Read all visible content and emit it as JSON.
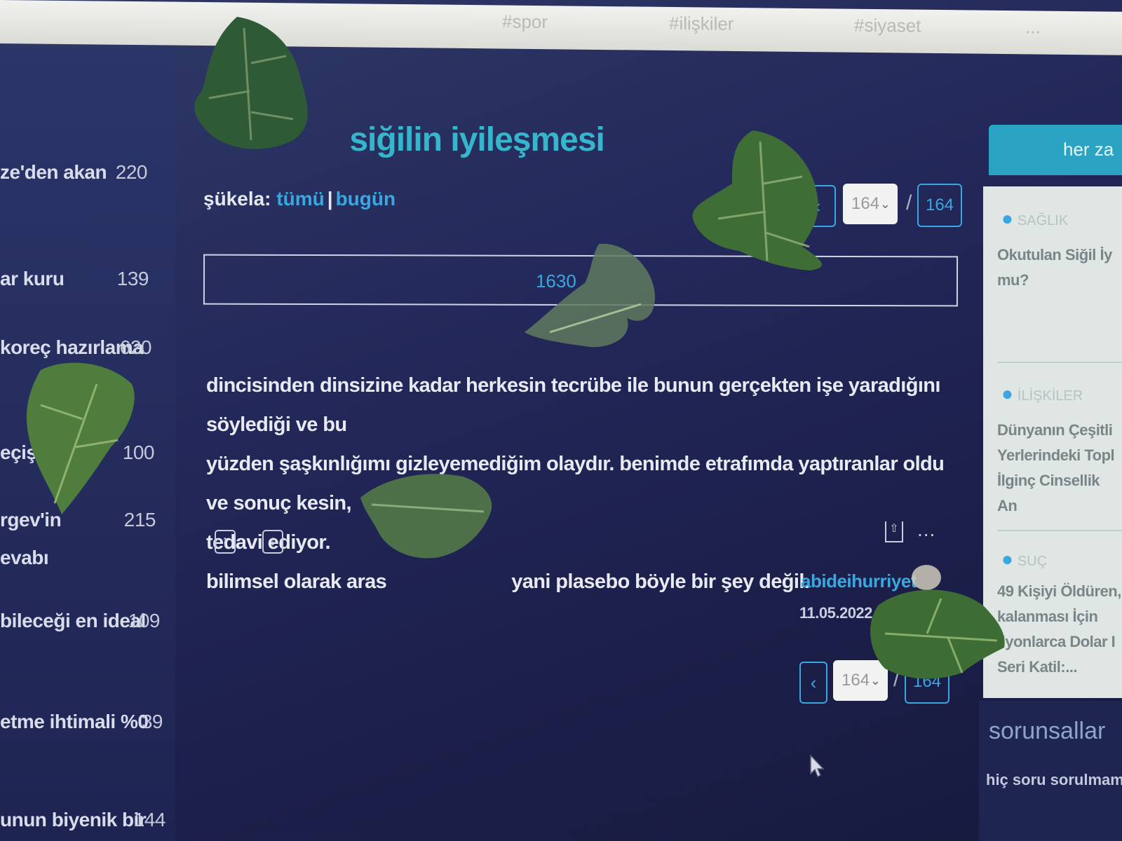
{
  "top_nav": {
    "items": [
      "#spor",
      "#ilişkiler",
      "#siyaset",
      "..."
    ]
  },
  "left_topics": [
    {
      "title": "ze'den akan",
      "count": "220"
    },
    {
      "title": "ar kuru",
      "count": "139"
    },
    {
      "title": "koreç hazırlama",
      "count": "620"
    },
    {
      "title": "eçiş",
      "count": "100"
    },
    {
      "title": "rgev'in",
      "count": "215"
    },
    {
      "title": "evabı",
      "count": ""
    },
    {
      "title": "bileceği en ideal",
      "count": "109"
    },
    {
      "title": "etme ihtimali %0",
      "count": "39"
    },
    {
      "title": "unun biyenik bir",
      "count": "144"
    }
  ],
  "topic": {
    "title": "siğilin iyileşmesi",
    "sukela_label": "şükela:",
    "sukela_all": "tümü",
    "sukela_sep": "|",
    "sukela_today": "bugün"
  },
  "pager_top": {
    "current": "164",
    "slash": "/",
    "total": "164"
  },
  "more_entries_button": "1630",
  "entry": {
    "line1": "dincisinden dinsizine kadar herkesin tecrübe ile bunun gerçekten işe yaradığını söylediği ve bu",
    "line2": "yüzden şaşkınlığımı gizleyemediğim olaydır. benimde etrafımda yaptıranlar oldu ve sonuç kesin,",
    "line3": "tedavi ediyor.",
    "line4_start": "bilimsel olarak aras",
    "line4_end": "yani plasebo böyle bir şey değil.",
    "author": "abideihurriyet",
    "date": "11.05.2022 02:2",
    "upvote": "↑",
    "downvote": "↓",
    "more": "..."
  },
  "pager_bottom": {
    "prev": "‹",
    "current": "164",
    "slash": "/",
    "total": "164"
  },
  "right_rail": {
    "header": "her za",
    "items": [
      {
        "tag": "SAĞLIK",
        "text": "Okutulan Siğil İy\nmu?"
      },
      {
        "tag": "İLİŞKİLER",
        "text": "Dünyanın Çeşitli\nYerlerindeki Topl\nİlginç Cinsellik An"
      },
      {
        "tag": "SUÇ",
        "text": "49 Kişiyi Öldüren,\nkalanması İçin\nilyonlarca Dolar I\nSeri Katil:..."
      }
    ],
    "footer_title": "sorunsallar",
    "footer_text": "hiç soru sorulmam"
  },
  "colors": {
    "accent": "#3aa8e0",
    "title": "#35b6cc",
    "background": "#23285a",
    "leaf": "#3f6a3a"
  }
}
